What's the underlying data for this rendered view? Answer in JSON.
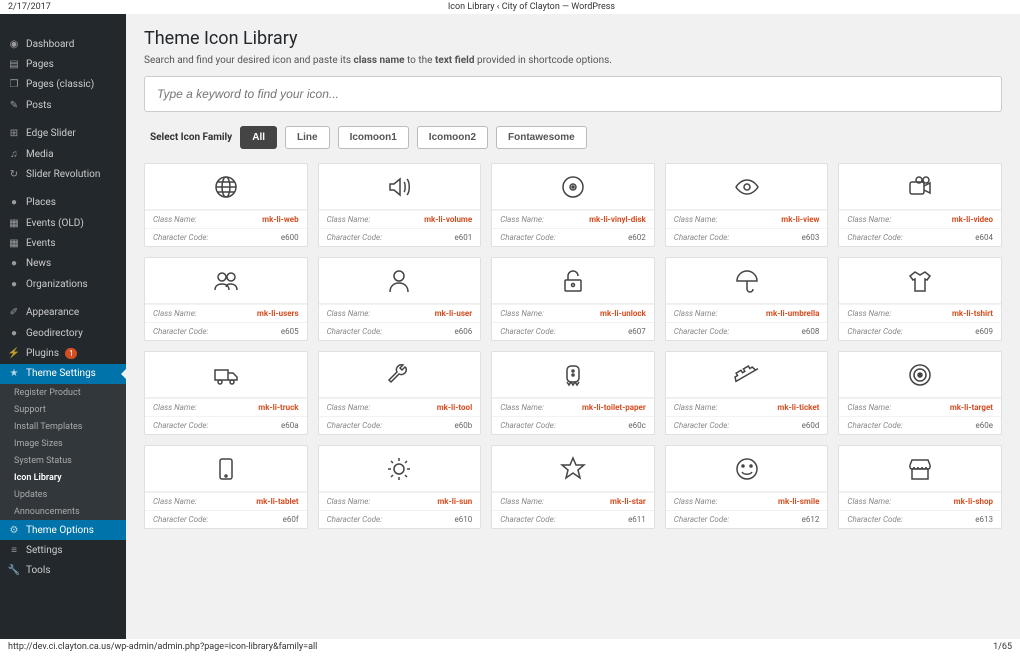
{
  "meta": {
    "date": "2/17/2017",
    "title": "Icon Library ‹ City of Clayton — WordPress",
    "footer_url": "http://dev.ci.clayton.ca.us/wp-admin/admin.php?page=icon-library&family=all",
    "footer_page": "1/65"
  },
  "sidebar": {
    "items": [
      {
        "label": "Dashboard",
        "icon": "gauge"
      },
      {
        "label": "Pages",
        "icon": "page"
      },
      {
        "label": "Pages (classic)",
        "icon": "pages"
      },
      {
        "label": "Posts",
        "icon": "pin"
      },
      {
        "label": "Edge Slider",
        "icon": "slider"
      },
      {
        "label": "Media",
        "icon": "media"
      },
      {
        "label": "Slider Revolution",
        "icon": "refresh"
      },
      {
        "label": "Places",
        "icon": "dot"
      },
      {
        "label": "Events (OLD)",
        "icon": "calendar-color"
      },
      {
        "label": "Events",
        "icon": "calendar"
      },
      {
        "label": "News",
        "icon": "dot"
      },
      {
        "label": "Organizations",
        "icon": "dot"
      },
      {
        "label": "Appearance",
        "icon": "brush"
      },
      {
        "label": "Geodirectory",
        "icon": "dot"
      },
      {
        "label": "Plugins",
        "icon": "plug",
        "badge": "1"
      },
      {
        "label": "Theme Settings",
        "icon": "star",
        "active": true
      },
      {
        "label": "Theme Options",
        "icon": "gear",
        "options": true
      },
      {
        "label": "Settings",
        "icon": "sliders"
      },
      {
        "label": "Tools",
        "icon": "wrench"
      }
    ],
    "subs": [
      "Register Product",
      "Support",
      "Install Templates",
      "Image Sizes",
      "System Status",
      "Icon Library",
      "Updates",
      "Announcements"
    ],
    "sub_current": 5
  },
  "header": {
    "title": "Theme Icon Library",
    "desc_pre": "Search and find your desired icon and paste its ",
    "desc_b1": "class name",
    "desc_mid": " to the ",
    "desc_b2": "text field",
    "desc_post": " provided in shortcode options.",
    "placeholder": "Type a keyword to find your icon...",
    "filter_label": "Select Icon Family",
    "filters": [
      "All",
      "Line",
      "Icomoon1",
      "Icomoon2",
      "Fontawesome"
    ],
    "filter_active": 0,
    "class_lbl": "Class Name:",
    "code_lbl": "Character Code:"
  },
  "icons": [
    {
      "class": "mk-li-web",
      "code": "e600",
      "svg": "globe"
    },
    {
      "class": "mk-li-volume",
      "code": "e601",
      "svg": "volume"
    },
    {
      "class": "mk-li-vinyl-disk",
      "code": "e602",
      "svg": "disk"
    },
    {
      "class": "mk-li-view",
      "code": "e603",
      "svg": "eye"
    },
    {
      "class": "mk-li-video",
      "code": "e604",
      "svg": "video"
    },
    {
      "class": "mk-li-users",
      "code": "e605",
      "svg": "users"
    },
    {
      "class": "mk-li-user",
      "code": "e606",
      "svg": "user"
    },
    {
      "class": "mk-li-unlock",
      "code": "e607",
      "svg": "unlock"
    },
    {
      "class": "mk-li-umbrella",
      "code": "e608",
      "svg": "umbrella"
    },
    {
      "class": "mk-li-tshirt",
      "code": "e609",
      "svg": "tshirt"
    },
    {
      "class": "mk-li-truck",
      "code": "e60a",
      "svg": "truck"
    },
    {
      "class": "mk-li-tool",
      "code": "e60b",
      "svg": "tool"
    },
    {
      "class": "mk-li-toilet-paper",
      "code": "e60c",
      "svg": "paper"
    },
    {
      "class": "mk-li-ticket",
      "code": "e60d",
      "svg": "ticket"
    },
    {
      "class": "mk-li-target",
      "code": "e60e",
      "svg": "target"
    },
    {
      "class": "mk-li-tablet",
      "code": "e60f",
      "svg": "tablet"
    },
    {
      "class": "mk-li-sun",
      "code": "e610",
      "svg": "sun"
    },
    {
      "class": "mk-li-star",
      "code": "e611",
      "svg": "star"
    },
    {
      "class": "mk-li-smile",
      "code": "e612",
      "svg": "smile"
    },
    {
      "class": "mk-li-shop",
      "code": "e613",
      "svg": "shop"
    }
  ]
}
